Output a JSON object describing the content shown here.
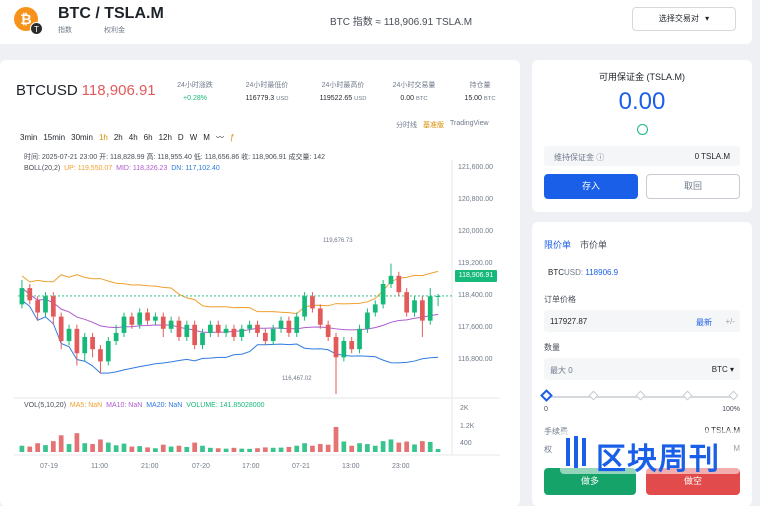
{
  "header": {
    "coin_symbol": "BTC",
    "pair_title": "BTC / TSLA.M",
    "pair_sub_left": "指数",
    "pair_sub_right": "权利金",
    "index_info": "BTC 指数 ≈ 118,906.91 TSLA.M",
    "select_pair_label": "选择交易对",
    "icons": [
      "bitcoin-icon",
      "chevron-down-icon"
    ]
  },
  "ticker": {
    "symbol": "BTCUSD",
    "price": "118,906.91",
    "stats": [
      {
        "label": "24小时涨跌",
        "value": "+0.28%"
      },
      {
        "label": "24小时最低价",
        "value": "116779.3",
        "unit": "USD"
      },
      {
        "label": "24小时最高价",
        "value": "119522.65",
        "unit": "USD"
      },
      {
        "label": "24小时交易量",
        "value": "0.00",
        "unit": "BTC"
      },
      {
        "label": "持仓量",
        "value": "15.00",
        "unit": "BTC"
      }
    ]
  },
  "chart_modes": {
    "time": "分时线",
    "basic": "基准版",
    "tv": "TradingView"
  },
  "intervals": [
    "3min",
    "15min",
    "30min",
    "1h",
    "2h",
    "4h",
    "6h",
    "12h",
    "D",
    "W",
    "M"
  ],
  "active_interval": "1h",
  "ohlc_line": "时间: 2025-07-21 23:00    开: 118,828.99    高: 118,955.40    低: 118,656.86    收: 118,906.91    成交量: 142",
  "boll": {
    "name": "BOLL(20,2)",
    "up": "UP: 119,550.07",
    "mid": "MID: 118,326.23",
    "dn": "DN: 117,102.40"
  },
  "vol_legend": {
    "name": "VOL(5,10,20)",
    "ma5": "MA5: NaN",
    "ma10": "MA10: NaN",
    "ma20": "MA20: NaN",
    "volume": "VOLUME: 141.85028000"
  },
  "colors": {
    "up": "#16b979",
    "down": "#e25a5a",
    "accent": "#1a5fe8",
    "boll_up": "#f0a030",
    "boll_mid": "#b05cd0",
    "boll_dn": "#2f7be0"
  },
  "chart_data": {
    "type": "candlestick",
    "y_ticks": [
      "121,600.00",
      "120,800.00",
      "120,000.00",
      "119,200.00",
      "118,400.00",
      "117,600.00",
      "116,800.00"
    ],
    "ylim": [
      116500,
      121900
    ],
    "vol_ticks": [
      "2K",
      "1.2K",
      "400"
    ],
    "vol_max": 2200,
    "x_ticks": [
      "07-19",
      "11:00",
      "21:00",
      "07-20",
      "17:00",
      "07-21",
      "13:00",
      "23:00"
    ],
    "high_marker": "119,676.73",
    "low_marker": "116,467.02",
    "last_price": 118906.91,
    "last_price_label": "118,906.91",
    "candles": [
      [
        118700,
        119100,
        118600,
        119300,
        300
      ],
      [
        119100,
        118800,
        118700,
        119200,
        260
      ],
      [
        118800,
        118500,
        118300,
        118900,
        420
      ],
      [
        118500,
        118900,
        118400,
        119000,
        330
      ],
      [
        118900,
        118400,
        118200,
        119000,
        520
      ],
      [
        118400,
        117800,
        117600,
        118500,
        800
      ],
      [
        117800,
        118100,
        117700,
        118200,
        380
      ],
      [
        118100,
        117500,
        117200,
        118200,
        900
      ],
      [
        117500,
        117900,
        117300,
        118000,
        420
      ],
      [
        117900,
        117600,
        117400,
        118000,
        380
      ],
      [
        117600,
        117300,
        117000,
        117700,
        600
      ],
      [
        117300,
        117800,
        117200,
        117900,
        450
      ],
      [
        117800,
        118000,
        117700,
        118200,
        320
      ],
      [
        118000,
        118400,
        117900,
        118500,
        400
      ],
      [
        118400,
        118200,
        118100,
        118500,
        260
      ],
      [
        118200,
        118500,
        118100,
        118600,
        280
      ],
      [
        118500,
        118300,
        118200,
        118600,
        220
      ],
      [
        118300,
        118400,
        118200,
        118500,
        180
      ],
      [
        118400,
        118100,
        117900,
        118500,
        350
      ],
      [
        118100,
        118300,
        118000,
        118400,
        260
      ],
      [
        118300,
        117900,
        117800,
        118400,
        300
      ],
      [
        117900,
        118200,
        117800,
        118300,
        240
      ],
      [
        118200,
        117700,
        117600,
        118300,
        450
      ],
      [
        117700,
        118000,
        117600,
        118100,
        300
      ],
      [
        118000,
        118200,
        117900,
        118300,
        200
      ],
      [
        118200,
        118000,
        117900,
        118300,
        180
      ],
      [
        118000,
        118100,
        117900,
        118200,
        160
      ],
      [
        118100,
        117900,
        117800,
        118200,
        200
      ],
      [
        117900,
        118100,
        117800,
        118200,
        160
      ],
      [
        118100,
        118200,
        118000,
        118300,
        150
      ],
      [
        118200,
        118000,
        117900,
        118300,
        180
      ],
      [
        118000,
        117800,
        117700,
        118100,
        220
      ],
      [
        117800,
        118100,
        117700,
        118200,
        200
      ],
      [
        118100,
        118300,
        118000,
        118400,
        210
      ],
      [
        118300,
        118000,
        117900,
        118400,
        240
      ],
      [
        118000,
        118400,
        117900,
        118500,
        300
      ],
      [
        118400,
        118900,
        118300,
        119000,
        420
      ],
      [
        118900,
        118600,
        118500,
        119000,
        300
      ],
      [
        118600,
        118200,
        118100,
        118700,
        380
      ],
      [
        118200,
        117900,
        117800,
        118300,
        350
      ],
      [
        117900,
        117400,
        116500,
        118000,
        1200
      ],
      [
        117400,
        117800,
        117300,
        117900,
        500
      ],
      [
        117800,
        117600,
        117500,
        117900,
        300
      ],
      [
        117600,
        118100,
        117500,
        118200,
        420
      ],
      [
        118100,
        118500,
        118000,
        118600,
        380
      ],
      [
        118500,
        118700,
        118400,
        118800,
        300
      ],
      [
        118700,
        119200,
        118600,
        119300,
        520
      ],
      [
        119200,
        119400,
        119100,
        119700,
        600
      ],
      [
        119400,
        119000,
        118900,
        119500,
        450
      ],
      [
        119000,
        118500,
        118400,
        119100,
        500
      ],
      [
        118500,
        118800,
        118400,
        118900,
        360
      ],
      [
        118800,
        118300,
        117900,
        118900,
        520
      ],
      [
        118300,
        118900,
        118200,
        119100,
        480
      ],
      [
        118900,
        118907,
        118657,
        118955,
        142
      ]
    ]
  },
  "margin": {
    "title": "可用保证金 (TSLA.M)",
    "value": "0.00",
    "maint_label": "维持保证金",
    "maint_value": "0 TSLA.M",
    "deposit": "存入",
    "withdraw": "取回"
  },
  "order": {
    "tab_limit": "限价单",
    "tab_market": "市价单",
    "symbol_prefix": "BTC",
    "symbol_suffix": "USD:",
    "symbol_price": "118906.9",
    "price_label": "订单价格",
    "price_value": "117927.87",
    "latest": "最新",
    "step_sign": "+/-",
    "qty_label": "数量",
    "qty_max": "最大 0",
    "qty_unit": "BTC",
    "slider_min": "0",
    "slider_max": "100%",
    "slider_value": 0,
    "fee_label": "手续费",
    "fee_value": "0 TSLA.M",
    "margin_label": "权",
    "margin_value": "M",
    "buy": "做多",
    "sell": "做空"
  },
  "watermark": "区块周刊"
}
